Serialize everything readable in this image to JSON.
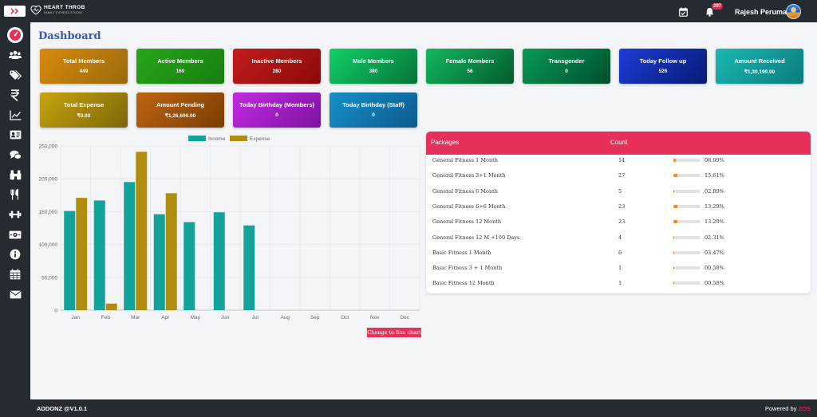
{
  "header": {
    "logo_main": "HEART THROB",
    "logo_sub": "FAMILY FITNESS STUDIO",
    "notification_count": "297",
    "username": "Rajesh Perumal"
  },
  "sidebar": {
    "items": [
      "dashboard-icon",
      "members-icon",
      "tags-icon",
      "rupee-icon",
      "chart-icon",
      "id-card-icon",
      "chat-icon",
      "binoculars-icon",
      "cutlery-icon",
      "dumbbell-icon",
      "cash-icon",
      "info-icon",
      "calendar-icon",
      "mail-icon"
    ]
  },
  "page_title": "Dashboard",
  "cards": [
    {
      "title": "Total Members",
      "value": "449",
      "c1": "#d9890b",
      "c2": "#9a6b0c"
    },
    {
      "title": "Active Members",
      "value": "169",
      "c1": "#27a51b",
      "c2": "#187e10"
    },
    {
      "title": "Inactive Members",
      "value": "280",
      "c1": "#c41b1b",
      "c2": "#8b0b0b"
    },
    {
      "title": "Male Members",
      "value": "390",
      "c1": "#10d068",
      "c2": "#06733b"
    },
    {
      "title": "Female Members",
      "value": "56",
      "c1": "#13b863",
      "c2": "#035a2d"
    },
    {
      "title": "Transgender",
      "value": "0",
      "c1": "#079a57",
      "c2": "#004f2b"
    },
    {
      "title": "Today Follow up",
      "value": "526",
      "c1": "#1c3cd8",
      "c2": "#071b75"
    },
    {
      "title": "Amount Received",
      "value": "₹1,30,199.00",
      "c1": "#1ab8b3",
      "c2": "#0a7c7c"
    },
    {
      "title": "Total Expense",
      "value": "₹0.00",
      "c1": "#c7a50f",
      "c2": "#7e6508"
    },
    {
      "title": "Amount Pending",
      "value": "₹1,26,699.00",
      "c1": "#bd6510",
      "c2": "#7b3d04"
    },
    {
      "title": "Today Birthday (Members)",
      "value": "0",
      "c1": "#c22be0",
      "c2": "#7e11a3"
    },
    {
      "title": "Today Birthday (Staff)",
      "value": "0",
      "c1": "#1690c9",
      "c2": "#0c5a8e"
    }
  ],
  "chart_data": {
    "type": "bar",
    "categories": [
      "Jan",
      "Feb",
      "Mar",
      "Apr",
      "May",
      "Jun",
      "Jul",
      "Aug",
      "Sep",
      "Oct",
      "Nov",
      "Dec"
    ],
    "series": [
      {
        "name": "Income",
        "color": "#13a39a",
        "values": [
          151000,
          167000,
          195000,
          146000,
          134000,
          149000,
          129000,
          null,
          null,
          null,
          null,
          null
        ]
      },
      {
        "name": "Expense",
        "color": "#b08d0e",
        "values": [
          171000,
          10000,
          241000,
          178000,
          null,
          null,
          null,
          null,
          null,
          null,
          null,
          null
        ]
      }
    ],
    "yticks": [
      "0",
      "50,000",
      "100,000",
      "150,000",
      "200,000",
      "250,000"
    ],
    "ylim": [
      0,
      250000
    ],
    "grid": true,
    "legend": "top-center"
  },
  "chart_button": "Change to line chart",
  "packages": {
    "col_name": "Packages",
    "col_count": "Count",
    "rows": [
      {
        "name": "General Fitness 1 Month",
        "count": "14",
        "percent": "08.09%",
        "pct": 8.09
      },
      {
        "name": "General Fitness 3+1 Month",
        "count": "27",
        "percent": "15.61%",
        "pct": 15.61
      },
      {
        "name": "General Fitness 6 Month",
        "count": "5",
        "percent": "02.89%",
        "pct": 2.89
      },
      {
        "name": "General Fitness 6+6 Month",
        "count": "23",
        "percent": "13.29%",
        "pct": 13.29
      },
      {
        "name": "General Fitness 12 Month",
        "count": "23",
        "percent": "13.29%",
        "pct": 13.29
      },
      {
        "name": "General Fitness 12 M +100 Days",
        "count": "4",
        "percent": "02.31%",
        "pct": 2.31
      },
      {
        "name": "Basic Fitness 1 Month",
        "count": "6",
        "percent": "03.47%",
        "pct": 3.47
      },
      {
        "name": "Basic Fitness 3 + 1 Month",
        "count": "1",
        "percent": "00.58%",
        "pct": 0.58
      },
      {
        "name": "Basic Fitness 12 Month",
        "count": "1",
        "percent": "00.58%",
        "pct": 0.58
      }
    ]
  },
  "footer": {
    "version": "ADDONZ @V1.0.1",
    "powered_label": "Powered by",
    "powered_brand": "ZOS"
  }
}
